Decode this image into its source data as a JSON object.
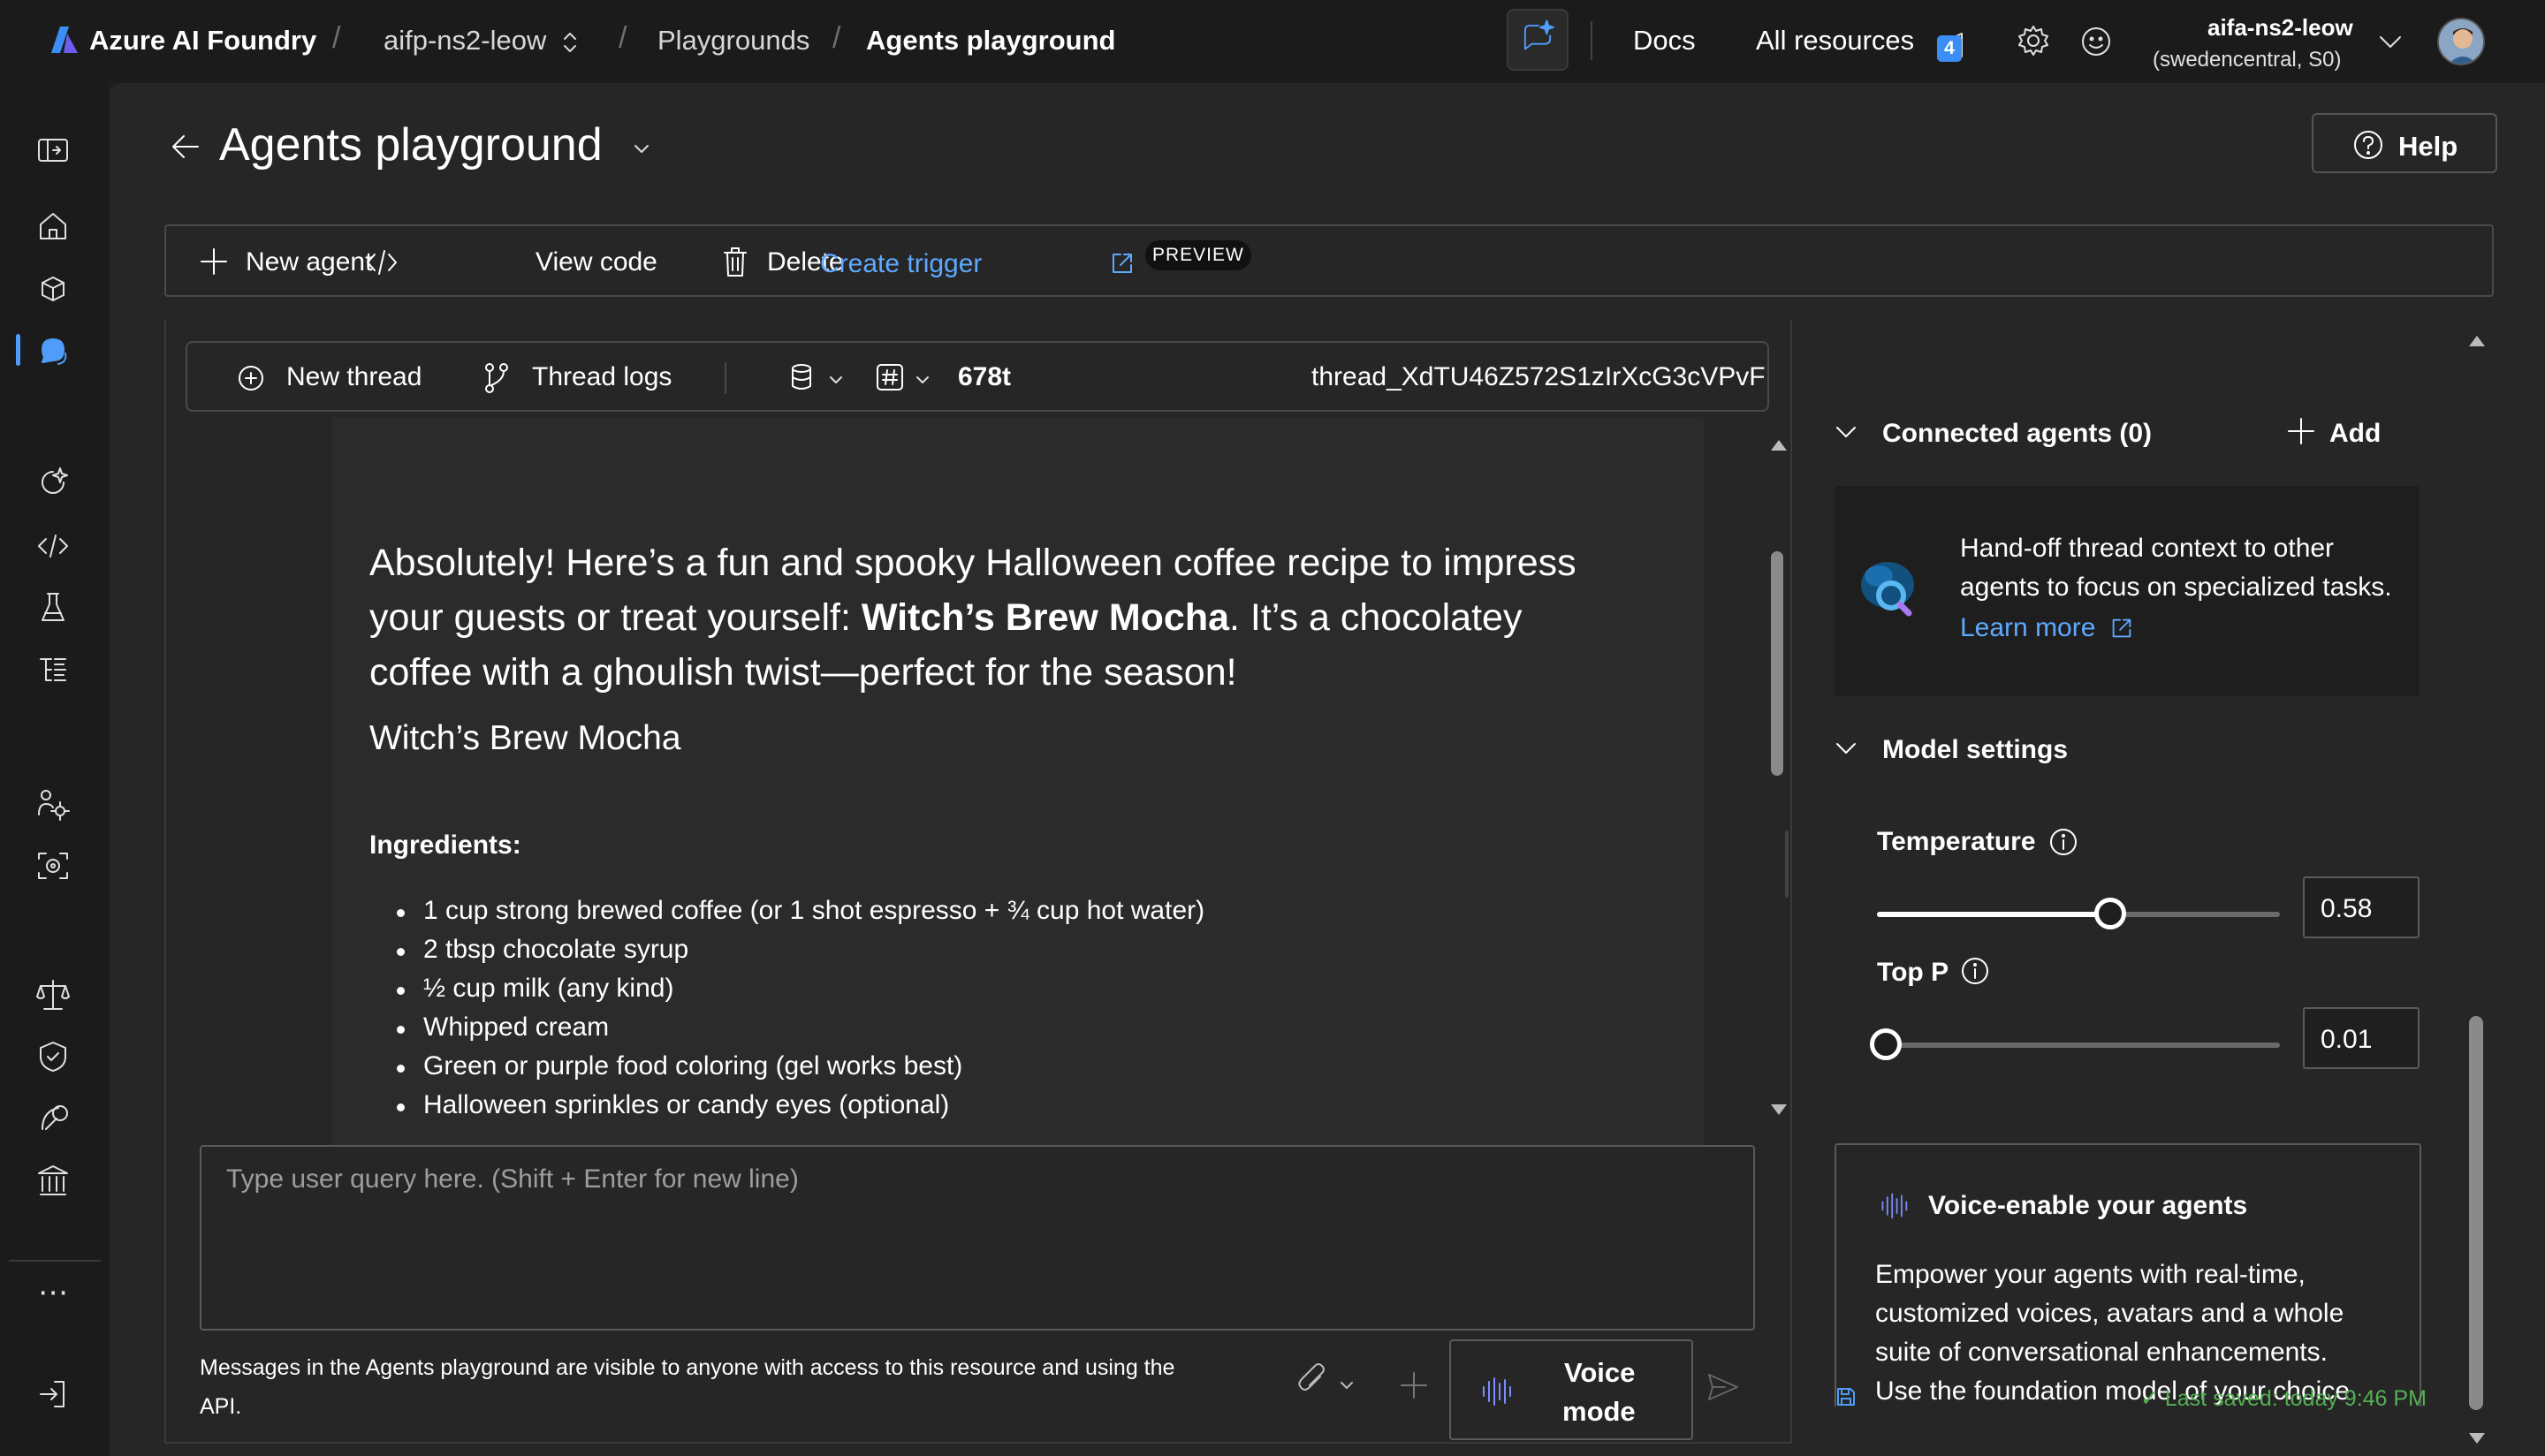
{
  "topbar": {
    "brand": "Azure AI Foundry",
    "project": "aifp-ns2-leow",
    "crumb_playgrounds": "Playgrounds",
    "crumb_current": "Agents playground",
    "docs": "Docs",
    "all_resources": "All resources",
    "notification_count": "4",
    "account_name": "aifa-ns2-leow",
    "account_region": "(swedencentral, S0)"
  },
  "page": {
    "title": "Agents playground",
    "help": "Help"
  },
  "toolbar": {
    "new_agent": "New agent",
    "view_code": "View code",
    "delete": "Delete",
    "create_trigger": "Create trigger",
    "preview_badge": "PREVIEW"
  },
  "thread": {
    "new_thread": "New thread",
    "thread_logs": "Thread logs",
    "token_count": "678t",
    "thread_id": "thread_XdTU46Z572S1zIrXcG3cVPvF",
    "more": "..."
  },
  "message": {
    "intro_1": "Absolutely! Here’s a fun and spooky Halloween coffee recipe to impress",
    "intro_2a": "your guests or treat yourself: ",
    "intro_2b": "Witch’s Brew Mocha",
    "intro_2c": ". It’s a chocolatey",
    "intro_3": "coffee with a ghoulish twist—perfect for the season!",
    "heading": "Witch’s Brew Mocha",
    "ingredients_label": "Ingredients:",
    "ingredients": [
      "1 cup strong brewed coffee (or 1 shot espresso + ¾ cup hot water)",
      "2 tbsp chocolate syrup",
      "½ cup milk (any kind)",
      "Whipped cream",
      "Green or purple food coloring (gel works best)",
      "Halloween sprinkles or candy eyes (optional)"
    ]
  },
  "composer": {
    "placeholder": "Type user query here. (Shift + Enter for new line)",
    "notice_1": "Messages in the Agents playground are visible to anyone with access to this resource and using the",
    "notice_2": "API.",
    "voice_1": "Voice",
    "voice_2": "mode"
  },
  "right_panel": {
    "connected_title": "Connected agents (0)",
    "add": "Add",
    "handoff_1": "Hand-off thread context to other",
    "handoff_2": "agents to focus on specialized tasks.",
    "learn_more": "Learn more",
    "model_settings": "Model settings",
    "temperature_label": "Temperature",
    "temperature_value": "0.58",
    "temperature_level": 0.58,
    "top_p_label": "Top P",
    "top_p_value": "0.01",
    "top_p_level": 0.01,
    "voice_title": "Voice-enable your agents",
    "voice_1": "Empower your agents with real-time,",
    "voice_2": "customized voices, avatars and a whole",
    "voice_3": "suite of conversational enhancements.",
    "voice_4": "Use the foundation model of your choice",
    "last_saved": "✓ Last saved: today 9:46 PM"
  },
  "colors": {
    "accent": "#4f9cf9",
    "saved_green": "#54b054",
    "background": "#1f1f1f",
    "panel": "#262626"
  }
}
